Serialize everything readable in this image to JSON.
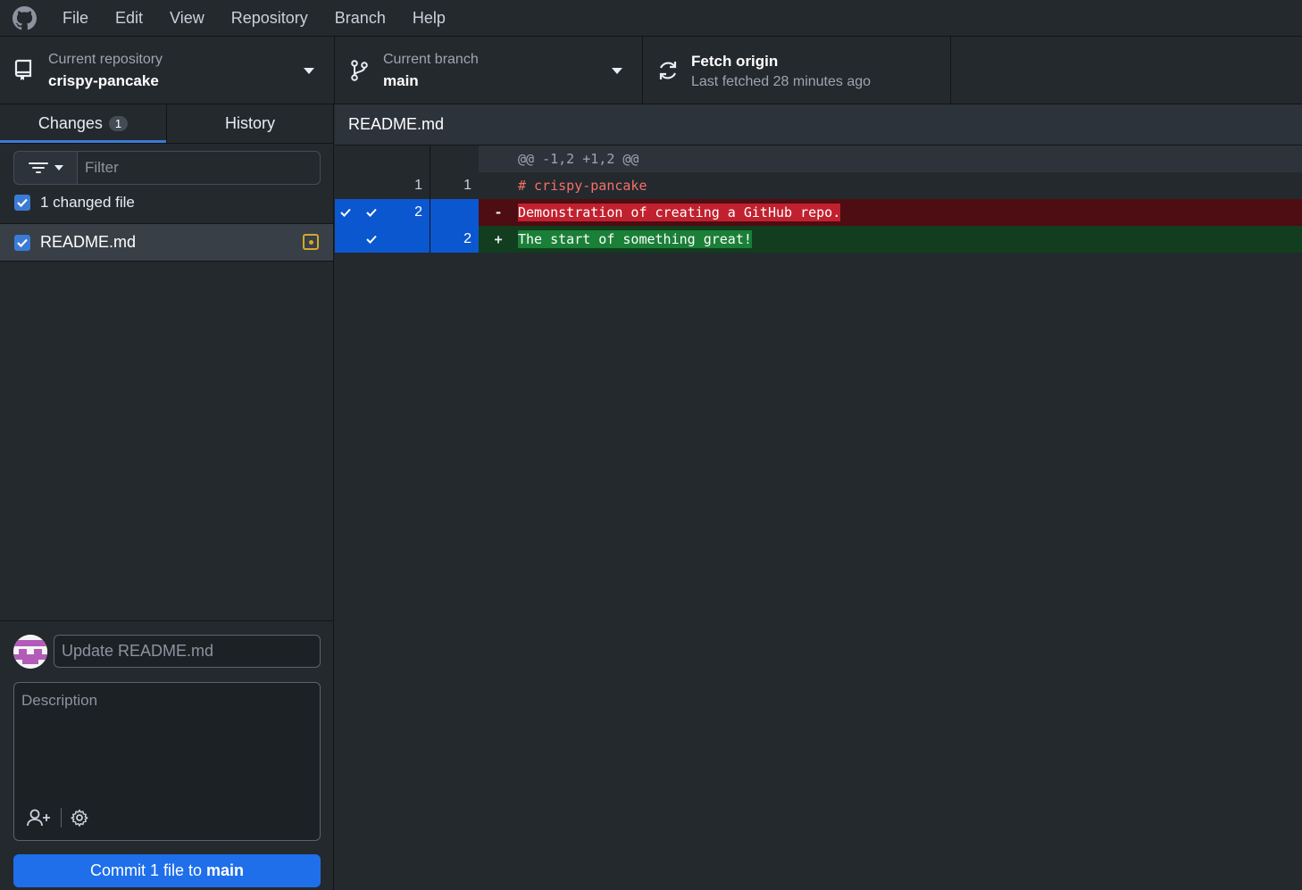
{
  "menu": {
    "items": [
      "File",
      "Edit",
      "View",
      "Repository",
      "Branch",
      "Help"
    ]
  },
  "toolbar": {
    "repo_label": "Current repository",
    "repo_value": "crispy-pancake",
    "branch_label": "Current branch",
    "branch_value": "main",
    "fetch_label": "Fetch origin",
    "fetch_value": "Last fetched 28 minutes ago"
  },
  "sidebar": {
    "tab_changes": "Changes",
    "tab_changes_count": "1",
    "tab_history": "History",
    "filter_placeholder": "Filter",
    "changed_summary": "1 changed file",
    "files": [
      {
        "name": "README.md",
        "status": "modified",
        "checked": true
      }
    ]
  },
  "commit": {
    "summary_placeholder": "Update README.md",
    "description_placeholder": "Description",
    "button_prefix": "Commit 1 file to",
    "button_branch": "main"
  },
  "diff": {
    "file_name": "README.md",
    "hunk_header": "@@ -1,2 +1,2 @@",
    "lines": [
      {
        "type": "context",
        "old": "1",
        "new": "1",
        "marker": "",
        "text": "# crispy-pancake"
      },
      {
        "type": "delete",
        "old": "2",
        "new": "",
        "marker": "-",
        "text": "Demonstration of creating a GitHub repo."
      },
      {
        "type": "add",
        "old": "",
        "new": "2",
        "marker": "+",
        "text": "The start of something great!"
      }
    ]
  },
  "colors": {
    "accent": "#1f6feb",
    "deleted_bg": "#c1212f",
    "added_bg": "#1a7f37",
    "modified": "#d4a72c"
  }
}
